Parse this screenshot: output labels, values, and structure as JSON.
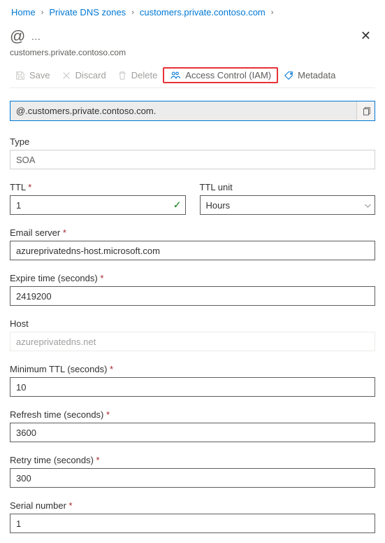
{
  "breadcrumb": {
    "items": [
      "Home",
      "Private DNS zones",
      "customers.private.contoso.com"
    ]
  },
  "header": {
    "icon_label": "@",
    "subtitle": "customers.private.contoso.com"
  },
  "toolbar": {
    "save": "Save",
    "discard": "Discard",
    "delete": "Delete",
    "iam": "Access Control (IAM)",
    "metadata": "Metadata"
  },
  "fqdn": "@.customers.private.contoso.com.",
  "form": {
    "type": {
      "label": "Type",
      "value": "SOA"
    },
    "ttl": {
      "label": "TTL",
      "value": "1"
    },
    "ttl_unit": {
      "label": "TTL unit",
      "value": "Hours"
    },
    "email_server": {
      "label": "Email server",
      "value": "azureprivatedns-host.microsoft.com"
    },
    "expire_time": {
      "label": "Expire time (seconds)",
      "value": "2419200"
    },
    "host": {
      "label": "Host",
      "value": "azureprivatedns.net"
    },
    "min_ttl": {
      "label": "Minimum TTL (seconds)",
      "value": "10"
    },
    "refresh_time": {
      "label": "Refresh time (seconds)",
      "value": "3600"
    },
    "retry_time": {
      "label": "Retry time (seconds)",
      "value": "300"
    },
    "serial": {
      "label": "Serial number",
      "value": "1"
    }
  }
}
